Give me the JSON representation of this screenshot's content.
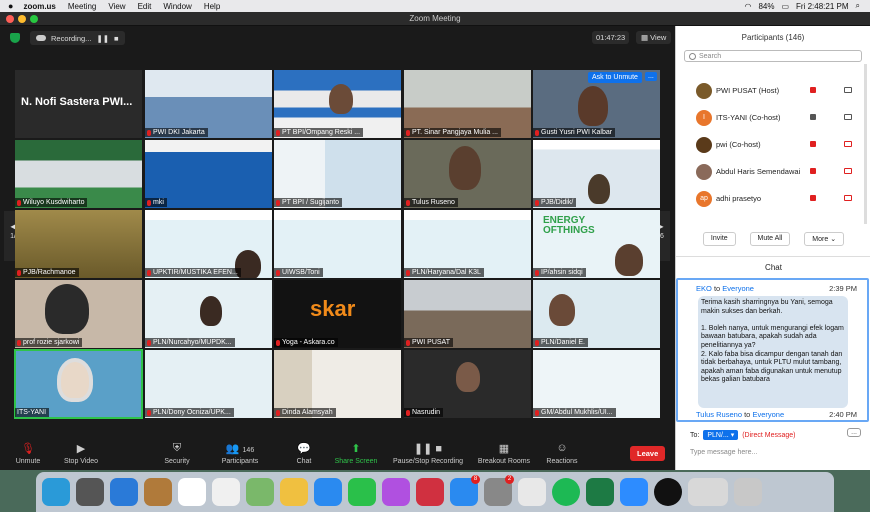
{
  "menubar": {
    "apple": "",
    "app": "zoom.us",
    "items": [
      "Meeting",
      "View",
      "Edit",
      "Window",
      "Help"
    ],
    "battery": "84%",
    "datetime": "Fri 2:48:21 PM"
  },
  "window": {
    "title": "Zoom Meeting"
  },
  "topstrip": {
    "recording": "Recording...",
    "timer": "01:47:23",
    "view": "View"
  },
  "nav": {
    "page_left": "1/6",
    "page_right": "1/6"
  },
  "tiles": [
    {
      "name": "N. Nofi Sastera PWI...",
      "label": ""
    },
    {
      "name": "",
      "label": "PWI DKI Jakarta"
    },
    {
      "name": "",
      "label": "PT BPI/Ompang Reski ..."
    },
    {
      "name": "",
      "label": "PT. Sinar Pangjaya Mulia ..."
    },
    {
      "name": "",
      "label": "Gusti Yusri PWI Kalbar",
      "ask": "Ask to Unmute",
      "more": "..."
    },
    {
      "name": "",
      "label": "Wiluyo Kusdwiharto"
    },
    {
      "name": "",
      "label": "mki"
    },
    {
      "name": "",
      "label": "PT BPI / Sugijanto"
    },
    {
      "name": "",
      "label": "Tulus Ruseno"
    },
    {
      "name": "",
      "label": "PJB/Didik/"
    },
    {
      "name": "",
      "label": "PJB/Rachmanoe"
    },
    {
      "name": "",
      "label": "UPKTIR/MUSTIKA EFEN..."
    },
    {
      "name": "",
      "label": "UIWSB/Toni"
    },
    {
      "name": "",
      "label": "PLN/Haryana/Dal K3L"
    },
    {
      "name": "",
      "label": "IP/ahsin sidqi"
    },
    {
      "name": "",
      "label": "prof rozie sjarkowi"
    },
    {
      "name": "",
      "label": "PLN/Nurcahyo/MUPDK..."
    },
    {
      "name": "",
      "label": "Yoga - Askara.co"
    },
    {
      "name": "",
      "label": "PWI PUSAT"
    },
    {
      "name": "",
      "label": "PLN/Daniel E."
    },
    {
      "name": "",
      "label": "ITS-YANI"
    },
    {
      "name": "",
      "label": "PLN/Dony Ocniza/UPK..."
    },
    {
      "name": "",
      "label": "Dinda Alamsyah"
    },
    {
      "name": "",
      "label": "Nasrudin"
    },
    {
      "name": "",
      "label": "GM/Abdul Mukhlis/UI..."
    }
  ],
  "slide_texts": {
    "energy": "ENERGY OFTHINGS",
    "askara": "skar",
    "bukit": "PT. BUKIT PE... INNOVATIVE"
  },
  "toolbar": {
    "unmute": "Unmute",
    "stop_video": "Stop Video",
    "security": "Security",
    "participants": "Participants",
    "participants_count": "146",
    "chat": "Chat",
    "share": "Share Screen",
    "record": "Pause/Stop Recording",
    "breakout": "Breakout Rooms",
    "reactions": "Reactions",
    "leave": "Leave"
  },
  "participants": {
    "title": "Participants (146)",
    "search_placeholder": "Search",
    "rows": [
      {
        "name": "PWI PUSAT (Host)",
        "avatar": "",
        "color": "#7a5a2a"
      },
      {
        "name": "ITS-YANI (Co-host)",
        "avatar": "I",
        "color": "#e8762c"
      },
      {
        "name": "pwi (Co-host)",
        "avatar": "",
        "color": "#5a3a1a"
      },
      {
        "name": "Abdul Haris Semendawai",
        "avatar": "",
        "color": "#8a6a5a"
      },
      {
        "name": "adhi prasetyo",
        "avatar": "ap",
        "color": "#e8762c"
      }
    ],
    "invite": "Invite",
    "mute_all": "Mute All",
    "more": "More"
  },
  "chat": {
    "title": "Chat",
    "msg1_from": "EKO",
    "msg1_to_word": "to",
    "msg1_to": "Everyone",
    "msg1_time": "2:39 PM",
    "msg1_text": "Terima kasih sharringnya bu Yani, semoga makin sukses dan berkah.\n\n1. Boleh nanya, untuk mengurangi efek logam bawaan batubara, apakah sudah ada penelitiannya ya?\n2. Kalo faba bisa dicampur dengan tanah dan tidak berbahaya, untuk PLTU mulut tambang, apakah aman faba digunakan untuk menutup bekas galian batubara",
    "msg2_from": "Tulus Ruseno",
    "msg2_to_word": "to",
    "msg2_to": "Everyone",
    "msg2_time": "2:40 PM",
    "to_label": "To:",
    "to_select": "PLN/...",
    "dm": "(Direct Message)",
    "ellipsis": "...",
    "input_placeholder": "Type message here..."
  },
  "dock_badges": {
    "appstore": "8",
    "settings": "2"
  },
  "colors": {
    "accent": "#0e71eb",
    "danger": "#e02828",
    "active": "#2fc34a"
  }
}
